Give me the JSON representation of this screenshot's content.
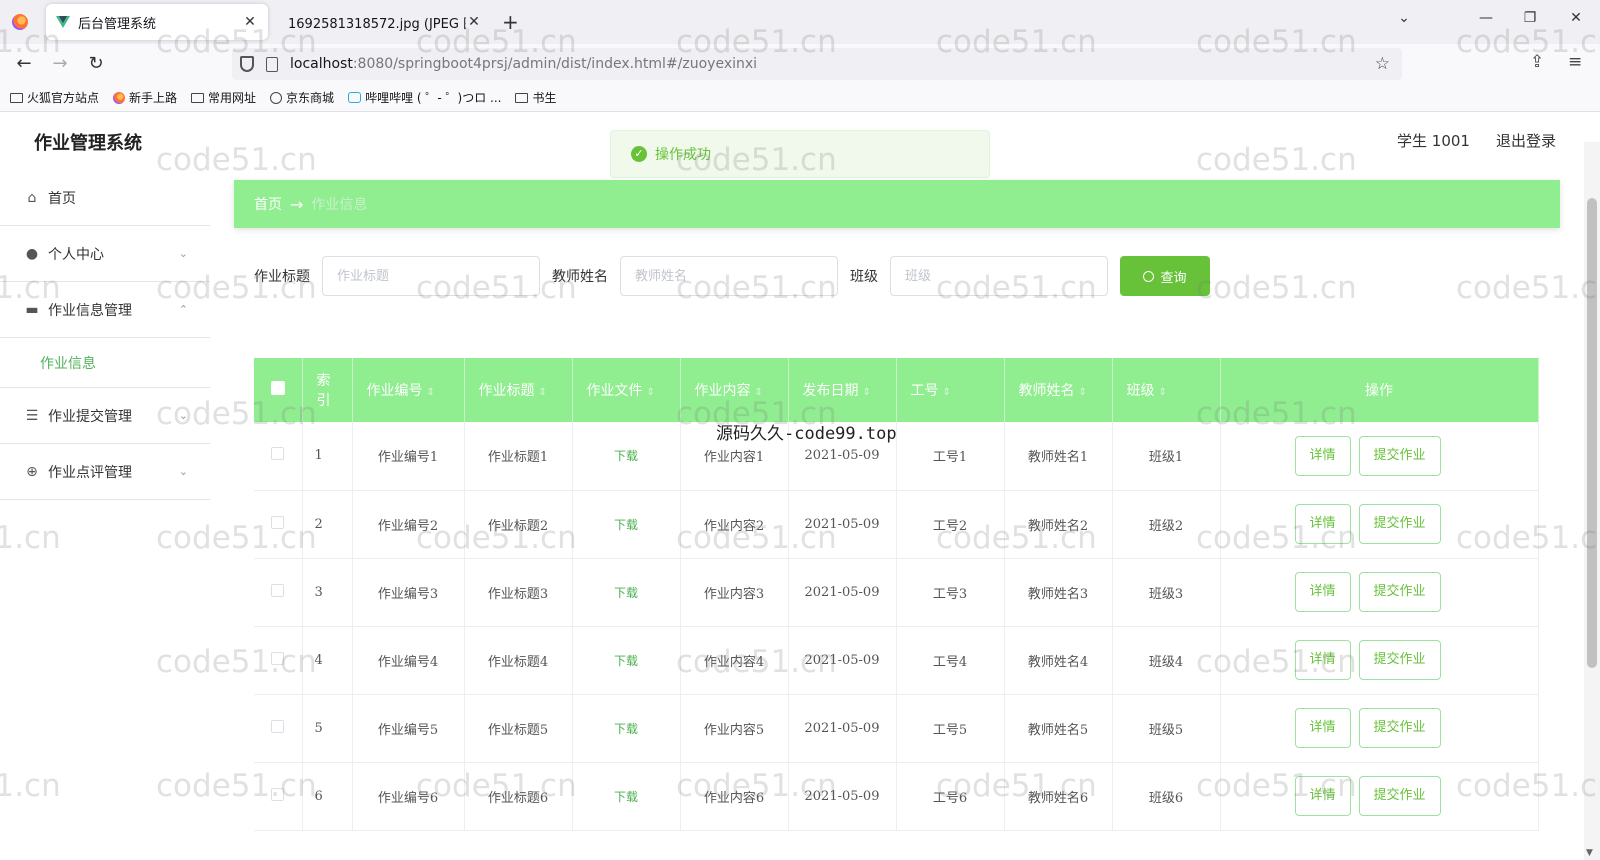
{
  "browser": {
    "tabs": [
      {
        "title": "后台管理系统",
        "active": true
      },
      {
        "title": "1692581318572.jpg (JPEG 图像,",
        "active": false
      }
    ],
    "url_host": "localhost",
    "url_path": ":8080/springboot4prsj/admin/dist/index.html#/zuoyexinxi",
    "bookmarks": [
      "火狐官方站点",
      "新手上路",
      "常用网址",
      "京东商城",
      "哔哩哔哩 ( ゜- ゜)つロ ...",
      "书生"
    ]
  },
  "app": {
    "title": "作业管理系统",
    "user_label": "学生 1001",
    "logout_label": "退出登录",
    "toast": "操作成功",
    "menu": {
      "home": "首页",
      "personal_center": "个人中心",
      "homework_info_mgmt": "作业信息管理",
      "homework_info": "作业信息",
      "homework_submit_mgmt": "作业提交管理",
      "homework_review_mgmt": "作业点评管理"
    },
    "breadcrumb": {
      "home": "首页",
      "separator": "→",
      "current": "作业信息"
    },
    "search": {
      "title_label": "作业标题",
      "title_placeholder": "作业标题",
      "teacher_label": "教师姓名",
      "teacher_placeholder": "教师姓名",
      "class_label": "班级",
      "class_placeholder": "班级",
      "query_button": "查询"
    },
    "table": {
      "headers": {
        "index": "索引",
        "homework_no": "作业编号",
        "homework_title": "作业标题",
        "homework_file": "作业文件",
        "homework_content": "作业内容",
        "publish_date": "发布日期",
        "staff_no": "工号",
        "teacher_name": "教师姓名",
        "class": "班级",
        "operation": "操作"
      },
      "rows": [
        {
          "index": "1",
          "no": "作业编号1",
          "title": "作业标题1",
          "file": "下载",
          "content": "作业内容1",
          "date": "2021-05-09",
          "staff": "工号1",
          "teacher": "教师姓名1",
          "class": "班级1"
        },
        {
          "index": "2",
          "no": "作业编号2",
          "title": "作业标题2",
          "file": "下载",
          "content": "作业内容2",
          "date": "2021-05-09",
          "staff": "工号2",
          "teacher": "教师姓名2",
          "class": "班级2"
        },
        {
          "index": "3",
          "no": "作业编号3",
          "title": "作业标题3",
          "file": "下载",
          "content": "作业内容3",
          "date": "2021-05-09",
          "staff": "工号3",
          "teacher": "教师姓名3",
          "class": "班级3"
        },
        {
          "index": "4",
          "no": "作业编号4",
          "title": "作业标题4",
          "file": "下载",
          "content": "作业内容4",
          "date": "2021-05-09",
          "staff": "工号4",
          "teacher": "教师姓名4",
          "class": "班级4"
        },
        {
          "index": "5",
          "no": "作业编号5",
          "title": "作业标题5",
          "file": "下载",
          "content": "作业内容5",
          "date": "2021-05-09",
          "staff": "工号5",
          "teacher": "教师姓名5",
          "class": "班级5"
        },
        {
          "index": "6",
          "no": "作业编号6",
          "title": "作业标题6",
          "file": "下载",
          "content": "作业内容6",
          "date": "2021-05-09",
          "staff": "工号6",
          "teacher": "教师姓名6",
          "class": "班级6"
        }
      ],
      "detail_button": "详情",
      "submit_button": "提交作业"
    },
    "overlay_text": "源码久久-code99.top",
    "watermark": "code51.cn"
  },
  "colors": {
    "accent_green": "#90ee90",
    "button_green": "#67c23a"
  }
}
